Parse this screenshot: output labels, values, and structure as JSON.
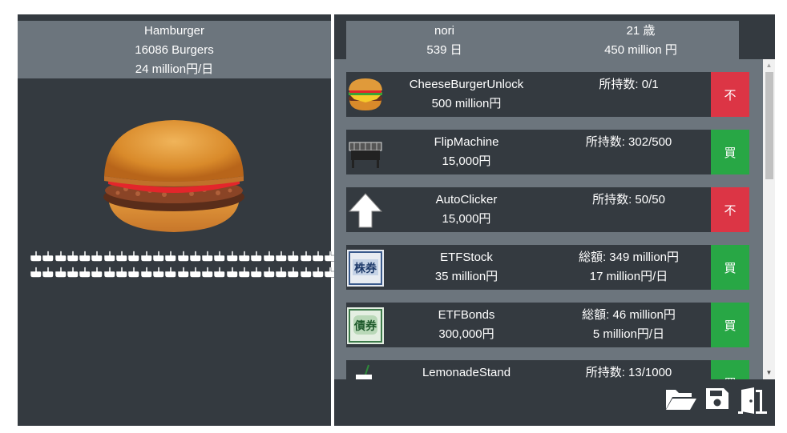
{
  "left": {
    "title": "Hamburger",
    "count": "16086 Burgers",
    "rate": "24 million円/日",
    "cursor_rows": 2,
    "cursors_per_row": 25
  },
  "user": {
    "name": "nori",
    "age": "21 歳",
    "days": "539 日",
    "money": "450 million 円"
  },
  "items": [
    {
      "name": "CheeseBurgerUnlock",
      "price": "500 million円",
      "info1": "所持数: 0/1",
      "info2": "",
      "button": "不",
      "button_color": "#dc3545",
      "icon": "cheeseburger-icon"
    },
    {
      "name": "FlipMachine",
      "price": "15,000円",
      "info1": "所持数: 302/500",
      "info2": "",
      "button": "買",
      "button_color": "#28a745",
      "icon": "grill-icon"
    },
    {
      "name": "AutoClicker",
      "price": "15,000円",
      "info1": "所持数: 50/50",
      "info2": "",
      "button": "不",
      "button_color": "#dc3545",
      "icon": "cursor-arrow-icon"
    },
    {
      "name": "ETFStock",
      "price": "35 million円",
      "info1": "総額: 349 million円",
      "info2": "17 million円/日",
      "button": "買",
      "button_color": "#28a745",
      "icon": "stock-certificate-icon"
    },
    {
      "name": "ETFBonds",
      "price": "300,000円",
      "info1": "総額: 46 million円",
      "info2": "5 million円/日",
      "button": "買",
      "button_color": "#28a745",
      "icon": "bond-certificate-icon"
    },
    {
      "name": "LemonadeStand",
      "price": "",
      "info1": "所持数: 13/1000",
      "info2": "",
      "button": "買",
      "button_color": "#28a745",
      "icon": "lemonade-icon"
    }
  ],
  "footer": {
    "icons": [
      "folder-open-icon",
      "save-icon",
      "exit-door-icon"
    ]
  }
}
